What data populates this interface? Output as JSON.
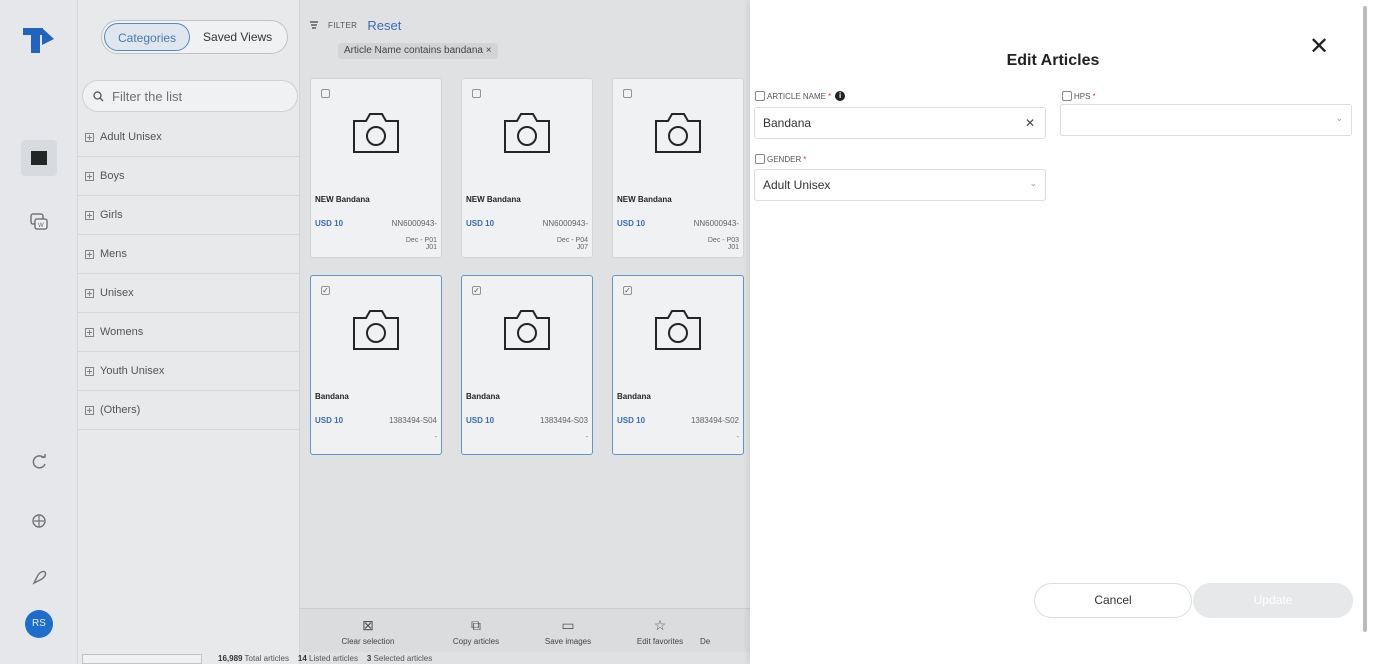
{
  "colors": {
    "accent": "#3a6fc0",
    "logo": "#1f67c9",
    "avatar": "#1c6fd6",
    "overlay": "rgba(70,80,90,0.08)"
  },
  "rail": {
    "avatar_initials": "RS",
    "icons": [
      "logo-icon",
      "book-icon",
      "whatsapp-icon",
      "refresh-icon",
      "gift-icon",
      "rocket-icon"
    ]
  },
  "sidebar": {
    "tabs": [
      {
        "label": "Categories",
        "active": true
      },
      {
        "label": "Saved Views",
        "active": false
      }
    ],
    "filter_placeholder": "Filter the list",
    "categories": [
      "Adult Unisex",
      "Boys",
      "Girls",
      "Mens",
      "Unisex",
      "Womens",
      "Youth Unisex",
      "(Others)"
    ]
  },
  "filter": {
    "label": "FILTER",
    "reset": "Reset",
    "chip": "Article Name contains bandana ×"
  },
  "articles": [
    {
      "name": "NEW Bandana",
      "price": "USD 10",
      "code": "NN6000943-",
      "sub": "Dec - P01\nJ01",
      "selected": false
    },
    {
      "name": "NEW Bandana",
      "price": "USD 10",
      "code": "NN6000943-",
      "sub": "Dec - P04\nJ07",
      "selected": false
    },
    {
      "name": "NEW Bandana",
      "price": "USD 10",
      "code": "NN6000943-",
      "sub": "Dec - P03\nJ01",
      "selected": false
    },
    {
      "name": "Bandana",
      "price": "USD 10",
      "code": "1383494-S04",
      "sub": "-",
      "selected": true
    },
    {
      "name": "Bandana",
      "price": "USD 10",
      "code": "1383494-S03",
      "sub": "-",
      "selected": true
    },
    {
      "name": "Bandana",
      "price": "USD 10",
      "code": "1383494-S02",
      "sub": "-",
      "selected": true
    }
  ],
  "toolbar": {
    "clear": "Clear selection",
    "copy": "Copy articles",
    "save": "Save images",
    "fav": "Edit favorites",
    "de": "De"
  },
  "status": {
    "total_count": "16,989",
    "total_label": "Total articles",
    "listed_count": "14",
    "listed_label": "Listed articles",
    "selected_count": "3",
    "selected_label": "Selected articles"
  },
  "modal": {
    "title": "Edit Articles",
    "article_name_label": "ARTICLE NAME",
    "article_name_value": "Bandana",
    "hps_label": "HPS",
    "hps_value": "",
    "gender_label": "GENDER",
    "gender_value": "Adult Unisex",
    "cancel": "Cancel",
    "update": "Update"
  }
}
